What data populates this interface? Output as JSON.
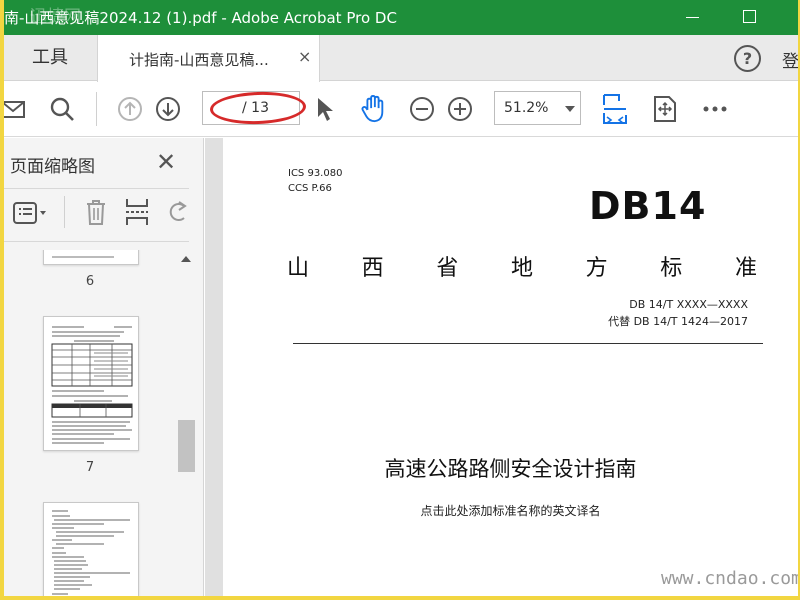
{
  "window": {
    "title": "南-山西意见稿2024.12 (1).pdf - Adobe Acrobat Pro DC",
    "watermark": "迅捷网"
  },
  "tabs": {
    "tools_label": "工具",
    "doc_tab_label": "计指南-山西意见稿...",
    "close_glyph": "×",
    "help_glyph": "?",
    "login_label": "登"
  },
  "toolbar": {
    "page_current": "",
    "page_total": "/ 13",
    "zoom_value": "51.2%",
    "highlight_color": "#d62a2a",
    "accent_color": "#1473e6"
  },
  "sidebar": {
    "title": "页面缩略图",
    "close_glyph": "✕",
    "thumbnails": [
      {
        "number": "6"
      },
      {
        "number": "7"
      },
      {
        "number": ""
      }
    ]
  },
  "document": {
    "ics": "ICS  93.080",
    "ccs": "CCS  P.66",
    "logo": "DB14",
    "standard_type": [
      "山",
      "西",
      "省",
      "地",
      "方",
      "标",
      "准"
    ],
    "std_number": "DB 14/T  XXXX—XXXX",
    "replaces": "代替 DB 14/T  1424—2017",
    "title": "高速公路路侧安全设计指南",
    "subtitle": "点击此处添加标准名称的英文译名",
    "site_watermark": "www.cndao.com"
  }
}
